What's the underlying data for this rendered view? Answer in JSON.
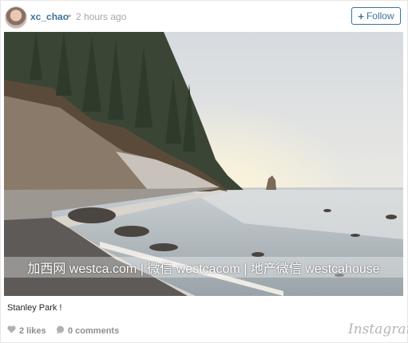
{
  "post": {
    "username": "xc_chao",
    "separator": "•",
    "time_ago": "2 hours ago",
    "follow_label": "Follow",
    "caption": "Stanley Park !",
    "watermark": "加西网 westca.com | 微信 westcacom | 地产微信 westcahouse"
  },
  "footer": {
    "likes": "2 likes",
    "comments": "0 comments",
    "brand": "Instagram"
  },
  "icons": {
    "avatar": "user-avatar",
    "follow": "plus-icon",
    "likes": "heart-icon",
    "comments": "comment-bubble-icon"
  },
  "colors": {
    "link_blue": "#3f729b",
    "muted_gray": "#8e8e8e"
  }
}
